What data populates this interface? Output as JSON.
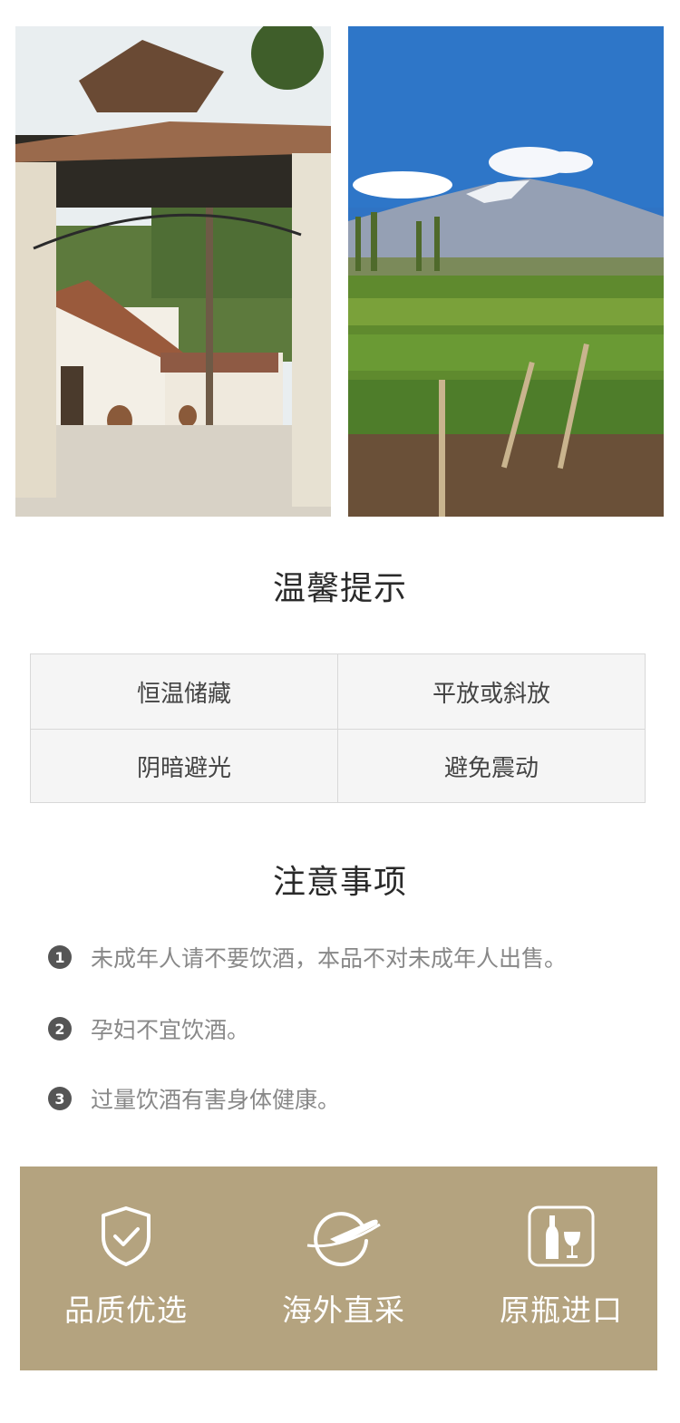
{
  "images": {
    "left": {
      "alt": "庄园入口拱门"
    },
    "right": {
      "alt": "雪山下的葡萄园"
    }
  },
  "tips": {
    "title": "温馨提示",
    "items": [
      "恒温储藏",
      "平放或斜放",
      "阴暗避光",
      "避免震动"
    ]
  },
  "notes": {
    "title": "注意事项",
    "items": [
      {
        "num": "1",
        "text": "未成年人请不要饮酒，本品不对未成年人出售。"
      },
      {
        "num": "2",
        "text": "孕妇不宜饮酒。"
      },
      {
        "num": "3",
        "text": "过量饮酒有害身体健康。"
      }
    ]
  },
  "features": [
    {
      "icon": "shield-check-icon",
      "label": "品质优选"
    },
    {
      "icon": "airplane-globe-icon",
      "label": "海外直采"
    },
    {
      "icon": "wine-bottle-glass-icon",
      "label": "原瓶进口"
    }
  ],
  "colors": {
    "banner": "#b4a37f",
    "badge": "#555555"
  }
}
